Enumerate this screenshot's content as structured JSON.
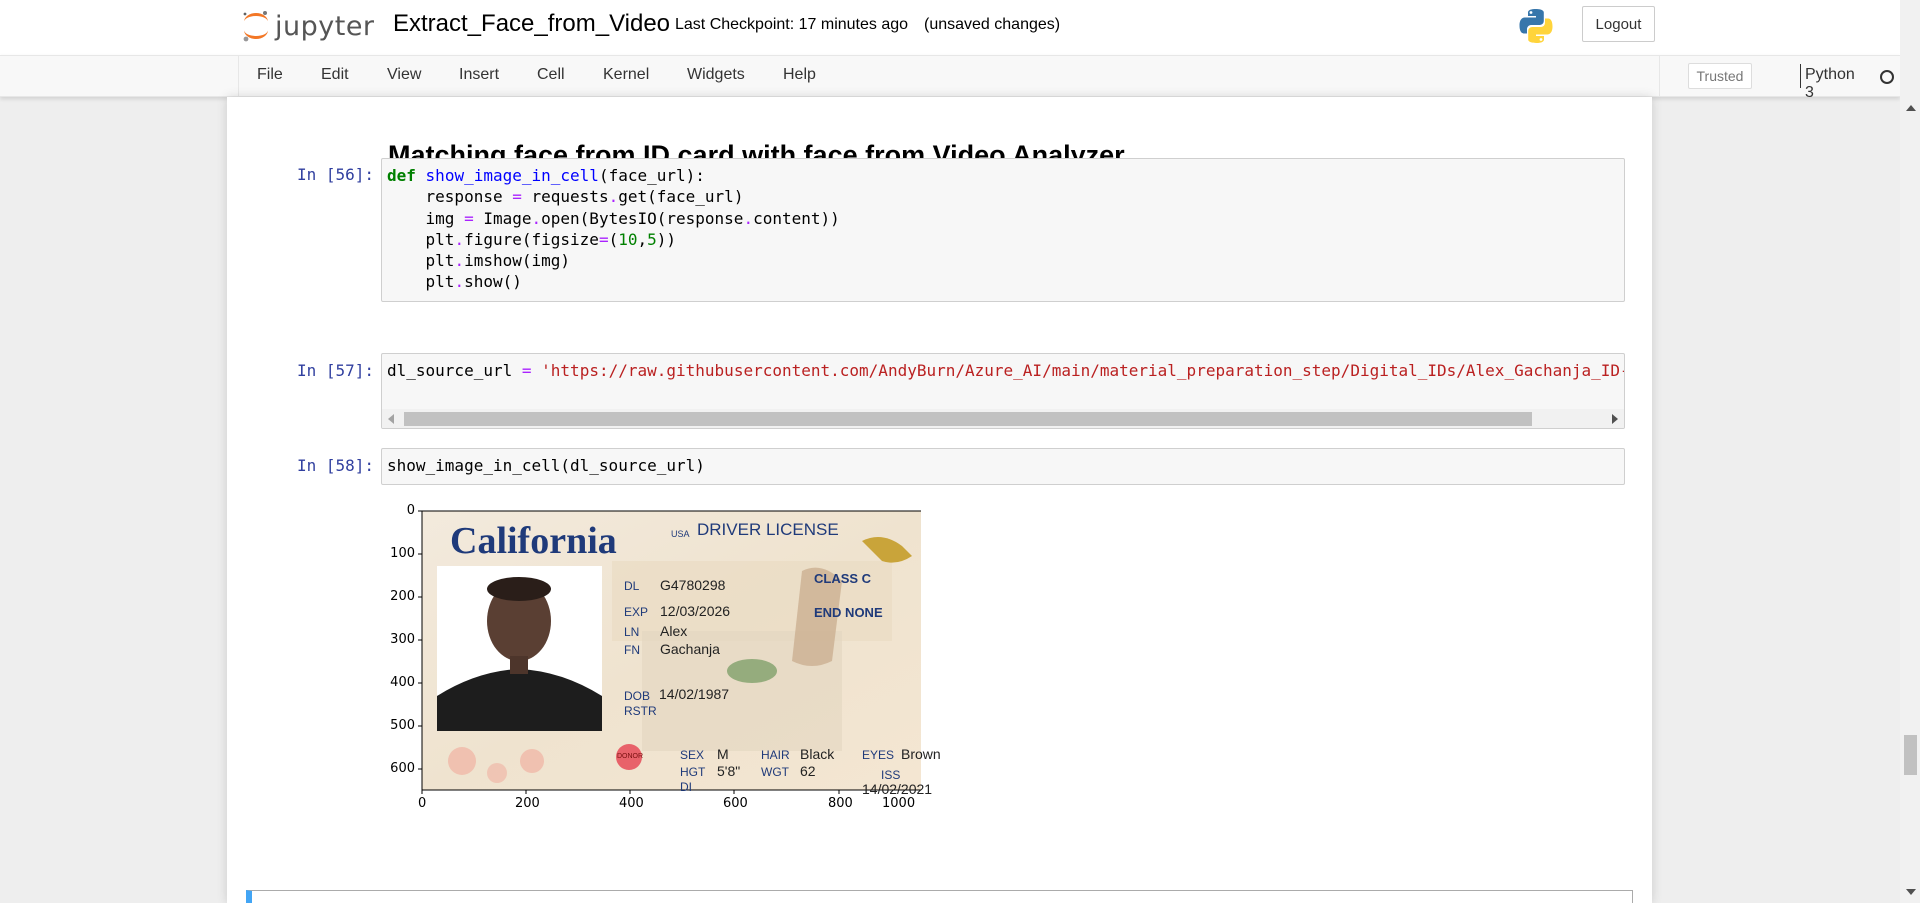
{
  "header": {
    "logo_text": "jupyter",
    "notebook_name": "Extract_Face_from_Video",
    "checkpoint": "Last Checkpoint: 17 minutes ago",
    "unsaved": "(unsaved changes)",
    "logout_label": "Logout"
  },
  "menubar": {
    "items": [
      "File",
      "Edit",
      "View",
      "Insert",
      "Cell",
      "Kernel",
      "Widgets",
      "Help"
    ],
    "trusted_label": "Trusted",
    "kernel_name": "Python 3"
  },
  "notebook": {
    "heading": "Matching face from ID card with face from Video Analyzer",
    "cells": [
      {
        "prompt": "In [56]:"
      },
      {
        "prompt": "In [57]:",
        "code_var": "dl_source_url",
        "code_op": "=",
        "code_string": "'https://raw.githubusercontent.com/AndyBurn/Azure_AI/main/material_preparation_step/Digital_IDs/Alex_Gachanja_ID-"
      },
      {
        "prompt": "In [58]:",
        "code": "show_image_in_cell(dl_source_url)"
      }
    ]
  },
  "id_card": {
    "state": "California",
    "country": "USA",
    "title": "DRIVER LICENSE",
    "dl_label": "DL",
    "dl_value": "G4780298",
    "exp_label": "EXP",
    "exp_value": "12/03/2026",
    "class_label": "CLASS C",
    "end_label": "END NONE",
    "ln_label": "LN",
    "ln_value": "Alex",
    "fn_label": "FN",
    "fn_value": "Gachanja",
    "dob_label": "DOB",
    "dob_value": "14/02/1987",
    "rstr_label": "RSTR",
    "donor_label": "DONOR",
    "sex_label": "SEX",
    "sex_value": "M",
    "hair_label": "HAIR",
    "hair_value": "Black",
    "eyes_label": "EYES",
    "eyes_value": "Brown",
    "hgt_label": "HGT",
    "hgt_value": "5'8\"",
    "wgt_label": "WGT",
    "wgt_value": "62",
    "dd_label": "DI",
    "iss_label": "ISS",
    "iss_value": "14/02/2021"
  },
  "plot": {
    "y_ticks": [
      "0",
      "100",
      "200",
      "300",
      "400",
      "500",
      "600"
    ],
    "x_ticks": [
      "0",
      "200",
      "400",
      "600",
      "800",
      "1000"
    ]
  },
  "colors": {
    "prompt": "#303f9f",
    "keyword": "#008000",
    "function": "#0000ff",
    "operator": "#aa22ff",
    "string": "#ba2121",
    "card_blue": "#1f3a7a",
    "jupyter_orange": "#f37726"
  }
}
